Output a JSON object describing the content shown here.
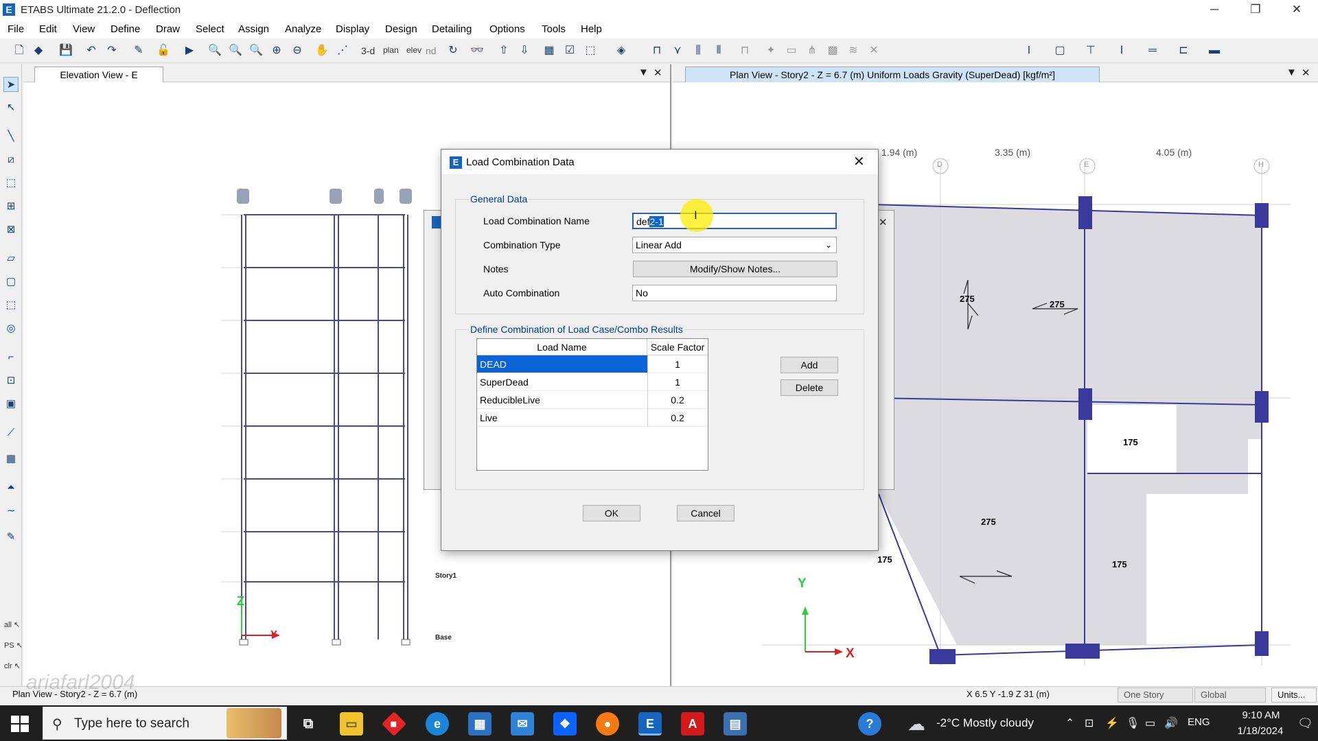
{
  "window": {
    "title": "ETABS Ultimate 21.2.0 - Deflection",
    "logo_letter": "E",
    "minimize": "─",
    "restore": "❐",
    "close": "✕"
  },
  "menu": [
    "File",
    "Edit",
    "View",
    "Define",
    "Draw",
    "Select",
    "Assign",
    "Analyze",
    "Display",
    "Design",
    "Detailing",
    "Options",
    "Tools",
    "Help"
  ],
  "toolbar": {
    "view_3d": "3-d",
    "plan": "plan",
    "elev": "elev",
    "nd": "nd"
  },
  "panes": {
    "left": {
      "tab": "Elevation View - E",
      "story_labels": [
        "Story1",
        "Base"
      ],
      "axis_z": "Z",
      "axis_y": "Y"
    },
    "right": {
      "tab": "Plan View - Story2 - Z = 6.7 (m)  Uniform Loads Gravity  (SuperDead)  [kgf/m²]",
      "dims": [
        "1.94 (m)",
        "3.35 (m)",
        "4.05 (m)"
      ],
      "grid_bubbles": [
        "D",
        "E",
        "H"
      ],
      "loads": [
        "275",
        "275",
        "175",
        "275",
        "175",
        "175"
      ],
      "axis_y": "Y",
      "axis_x": "X"
    },
    "dropdown_arrow": "▼",
    "close": "✕"
  },
  "dialog": {
    "title": "Load Combination Data",
    "logo_letter": "E",
    "close": "✕",
    "general_group": "General Data",
    "name_label": "Load Combination Name",
    "name_value": "def2-1",
    "type_label": "Combination Type",
    "type_value": "Linear Add",
    "notes_label": "Notes",
    "notes_button": "Modify/Show Notes...",
    "auto_label": "Auto Combination",
    "auto_value": "No",
    "define_group": "Define Combination of Load Case/Combo Results",
    "col_load": "Load Name",
    "col_scale": "Scale Factor",
    "rows": [
      {
        "name": "DEAD",
        "scale": "1"
      },
      {
        "name": "SuperDead",
        "scale": "1"
      },
      {
        "name": "ReducibleLive",
        "scale": "0.2"
      },
      {
        "name": "Live",
        "scale": "0.2"
      }
    ],
    "add": "Add",
    "delete": "Delete",
    "ok": "OK",
    "cancel": "Cancel"
  },
  "status": {
    "left": "Plan View - Story2 - Z = 6.7 (m)",
    "coords": "X 6.5  Y -1.9  Z 31 (m)",
    "story_mode": "One Story",
    "coord_system": "Global",
    "units": "Units...",
    "watermark": "ariafarl2004"
  },
  "taskbar": {
    "search_placeholder": "Type here to search",
    "weather": "-2°C  Mostly cloudy",
    "lang": "ENG",
    "time": "9:10 AM",
    "date": "1/18/2024"
  }
}
